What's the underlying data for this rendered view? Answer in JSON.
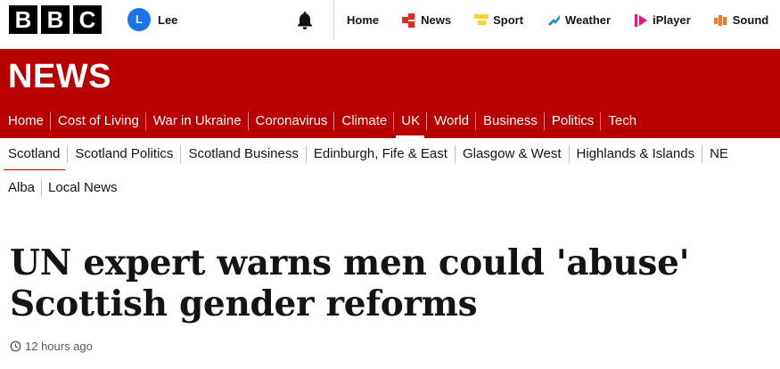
{
  "brand": {
    "letters": [
      "B",
      "B",
      "C"
    ]
  },
  "account": {
    "initial": "L",
    "name": "Lee"
  },
  "top_nav": [
    {
      "label": "Home",
      "icon": "none"
    },
    {
      "label": "News",
      "icon": "news-icon",
      "color": "#e02a22"
    },
    {
      "label": "Sport",
      "icon": "sport-icon",
      "color": "#ffd230"
    },
    {
      "label": "Weather",
      "icon": "weather-icon",
      "color": "#1f8ed1"
    },
    {
      "label": "iPlayer",
      "icon": "iplayer-icon",
      "color": "#e6187e"
    },
    {
      "label": "Sound",
      "icon": "sound-icon",
      "color": "#f47b20"
    }
  ],
  "section": {
    "title": "NEWS",
    "color": "#b80000"
  },
  "primary_nav": [
    "Home",
    "Cost of Living",
    "War in Ukraine",
    "Coronavirus",
    "Climate",
    "UK",
    "World",
    "Business",
    "Politics",
    "Tech"
  ],
  "primary_nav_active": "UK",
  "secondary_nav": [
    "Scotland",
    "Scotland Politics",
    "Scotland Business",
    "Edinburgh, Fife & East",
    "Glasgow & West",
    "Highlands & Islands",
    "NE"
  ],
  "secondary_nav_active": "Scotland",
  "tertiary_nav": [
    "Alba",
    "Local News"
  ],
  "article": {
    "headline_line1": "UN expert warns men could 'abuse'",
    "headline_line2": "Scottish gender reforms",
    "timestamp": "12 hours ago"
  }
}
